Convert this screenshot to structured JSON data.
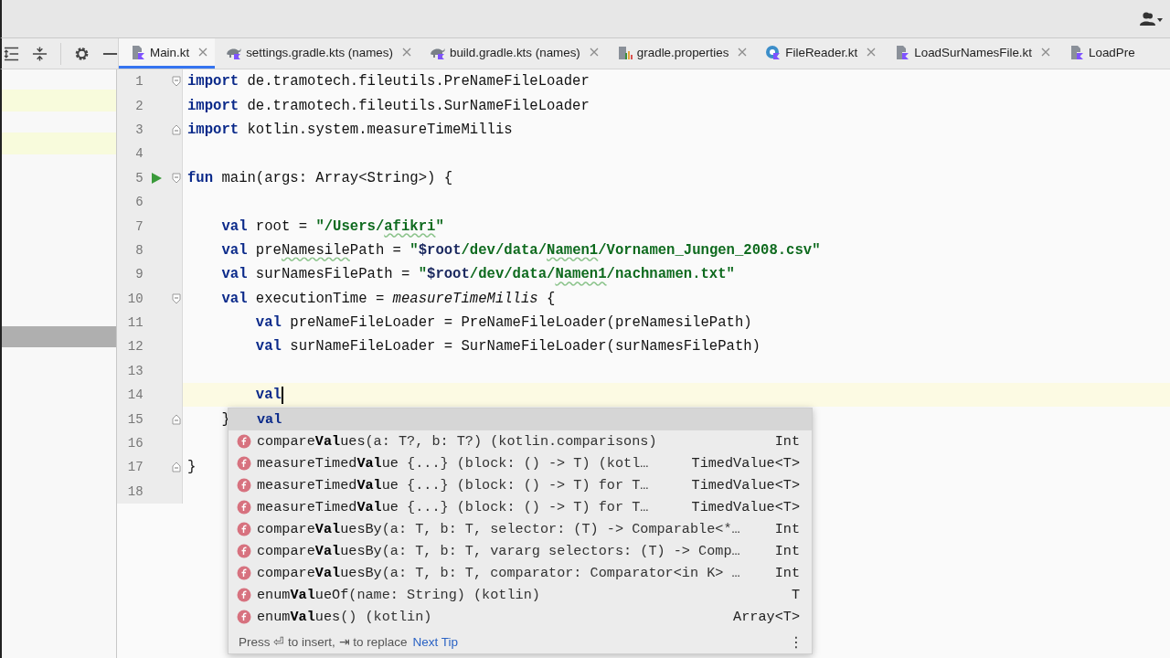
{
  "toolbar": {
    "buttons": [
      {
        "kind": "expand"
      },
      {
        "kind": "collapse"
      },
      {
        "kind": "settings"
      },
      {
        "kind": "hide"
      }
    ]
  },
  "tabs": [
    {
      "label": "Main.kt",
      "kind": "kotlin",
      "selected": true
    },
    {
      "label": "settings.gradle.kts (names)",
      "kind": "gradle",
      "selected": false
    },
    {
      "label": "build.gradle.kts (names)",
      "kind": "gradle",
      "selected": false
    },
    {
      "label": "gradle.properties",
      "kind": "properties",
      "selected": false
    },
    {
      "label": "FileReader.kt",
      "kind": "class",
      "selected": false
    },
    {
      "label": "LoadSurNamesFile.kt",
      "kind": "kotlin",
      "selected": false
    },
    {
      "label": "LoadPre",
      "kind": "kotlin",
      "selected": false
    }
  ],
  "side_panel": {
    "rows": [
      {
        "kind": "changed"
      },
      {
        "kind": "blank"
      },
      {
        "kind": "changed"
      },
      {
        "kind": "blank"
      },
      {
        "kind": "blank"
      },
      {
        "kind": "blank"
      },
      {
        "kind": "blank"
      },
      {
        "kind": "blank"
      },
      {
        "kind": "blank"
      },
      {
        "kind": "blank"
      },
      {
        "kind": "blank"
      },
      {
        "kind": "selected"
      }
    ]
  },
  "editor": {
    "lines": [
      {
        "number": "1",
        "fold_start": true,
        "fold_end": false,
        "run": false,
        "current": false,
        "tokens": [
          {
            "t": "import",
            "kind": "keyword"
          },
          {
            "t": " de.tramotech.fileutils.PreNameFileLoader",
            "kind": "plain"
          }
        ]
      },
      {
        "number": "2",
        "fold_start": false,
        "fold_end": false,
        "run": false,
        "current": false,
        "tokens": [
          {
            "t": "import",
            "kind": "keyword"
          },
          {
            "t": " de.tramotech.fileutils.SurNameFileLoader",
            "kind": "plain"
          }
        ]
      },
      {
        "number": "3",
        "fold_start": false,
        "fold_end": true,
        "run": false,
        "current": false,
        "tokens": [
          {
            "t": "import",
            "kind": "keyword"
          },
          {
            "t": " kotlin.system.measureTimeMillis",
            "kind": "plain"
          }
        ]
      },
      {
        "number": "4",
        "fold_start": false,
        "fold_end": false,
        "run": false,
        "current": false
      },
      {
        "number": "5",
        "fold_start": true,
        "fold_end": false,
        "run": true,
        "current": false,
        "tokens": [
          {
            "t": "fun",
            "kind": "keyword"
          },
          {
            "t": " main(args: Array<String>) {",
            "kind": "plain"
          }
        ]
      },
      {
        "number": "6",
        "fold_start": false,
        "fold_end": false,
        "run": false,
        "current": false
      },
      {
        "number": "7",
        "fold_start": false,
        "fold_end": false,
        "run": false,
        "current": false,
        "tokens": [
          {
            "t": "    val",
            "kind": "keyword"
          },
          {
            "t": " root = ",
            "kind": "plain"
          },
          {
            "t": "\"/Users/",
            "kind": "string"
          },
          {
            "t": "afikri",
            "kind": "misspelled_string"
          },
          {
            "t": "\"",
            "kind": "string"
          }
        ]
      },
      {
        "number": "8",
        "fold_start": false,
        "fold_end": false,
        "run": false,
        "current": false,
        "tokens": [
          {
            "t": "    val",
            "kind": "keyword"
          },
          {
            "t": " pre",
            "kind": "plain"
          },
          {
            "t": "Namesile",
            "kind": "misspelled"
          },
          {
            "t": "Path = ",
            "kind": "plain"
          },
          {
            "t": "\"",
            "kind": "string"
          },
          {
            "t": "$root",
            "kind": "template"
          },
          {
            "t": "/dev/data/",
            "kind": "string"
          },
          {
            "t": "Namen1",
            "kind": "misspelled_string"
          },
          {
            "t": "/Vornamen_Jungen_2008.csv\"",
            "kind": "string"
          }
        ]
      },
      {
        "number": "9",
        "fold_start": false,
        "fold_end": false,
        "run": false,
        "current": false,
        "tokens": [
          {
            "t": "    val",
            "kind": "keyword"
          },
          {
            "t": " surNamesFilePath = ",
            "kind": "plain"
          },
          {
            "t": "\"",
            "kind": "string"
          },
          {
            "t": "$root",
            "kind": "template"
          },
          {
            "t": "/dev/data/",
            "kind": "string"
          },
          {
            "t": "Namen1",
            "kind": "misspelled_string"
          },
          {
            "t": "/nachnamen.txt\"",
            "kind": "string"
          }
        ]
      },
      {
        "number": "10",
        "fold_start": true,
        "fold_end": false,
        "run": false,
        "current": false,
        "tokens": [
          {
            "t": "    val",
            "kind": "keyword"
          },
          {
            "t": " executionTime = ",
            "kind": "plain"
          },
          {
            "t": "measureTimeMillis",
            "kind": "italic"
          },
          {
            "t": " {",
            "kind": "plain"
          }
        ]
      },
      {
        "number": "11",
        "fold_start": false,
        "fold_end": false,
        "run": false,
        "current": false,
        "tokens": [
          {
            "t": "        val",
            "kind": "keyword"
          },
          {
            "t": " preNameFileLoader = PreNameFileLoader(preNamesilePath)",
            "kind": "plain"
          }
        ]
      },
      {
        "number": "12",
        "fold_start": false,
        "fold_end": false,
        "run": false,
        "current": false,
        "tokens": [
          {
            "t": "        val",
            "kind": "keyword"
          },
          {
            "t": " surNameFileLoader = SurNameFileLoader(surNamesFilePath)",
            "kind": "plain"
          }
        ]
      },
      {
        "number": "13",
        "fold_start": false,
        "fold_end": false,
        "run": false,
        "current": false
      },
      {
        "number": "14",
        "fold_start": false,
        "fold_end": false,
        "run": false,
        "current": true,
        "tokens": [
          {
            "t": "        val",
            "kind": "keyword"
          }
        ]
      },
      {
        "number": "15",
        "fold_start": false,
        "fold_end": true,
        "run": false,
        "current": false,
        "tokens": [
          {
            "t": "    }",
            "kind": "plain"
          }
        ]
      },
      {
        "number": "16",
        "fold_start": false,
        "fold_end": false,
        "run": false,
        "current": false
      },
      {
        "number": "17",
        "fold_start": false,
        "fold_end": true,
        "run": false,
        "current": false,
        "tokens": [
          {
            "t": "}",
            "kind": "plain"
          }
        ]
      },
      {
        "number": "18",
        "fold_start": false,
        "fold_end": false,
        "run": false,
        "current": false
      }
    ]
  },
  "completion": {
    "items": [
      {
        "kind": "keyword",
        "name": "val",
        "selected": true
      },
      {
        "kind": "function",
        "name": "compare**Val**ues",
        "detail": "(a: T?, b: T?) (kotlin.comparisons)",
        "type": "Int",
        "selected": false
      },
      {
        "kind": "function",
        "name": "measureTimed**Val**ue",
        "detail": " {...} (block: () -> T) (kotl…",
        "type": "TimedValue<T>",
        "selected": false
      },
      {
        "kind": "function",
        "name": "measureTimed**Val**ue",
        "detail": " {...} (block: () -> T) for T…",
        "type": "TimedValue<T>",
        "selected": false
      },
      {
        "kind": "function",
        "name": "measureTimed**Val**ue",
        "detail": " {...} (block: () -> T) for T…",
        "type": "TimedValue<T>",
        "selected": false
      },
      {
        "kind": "function",
        "name": "compare**Val**uesBy",
        "detail": "(a: T, b: T, selector: (T) -> Comparable<*…",
        "type": "Int",
        "selected": false
      },
      {
        "kind": "function",
        "name": "compare**Val**uesBy",
        "detail": "(a: T, b: T, vararg selectors: (T) -> Comp…",
        "type": "Int",
        "selected": false
      },
      {
        "kind": "function",
        "name": "compare**Val**uesBy",
        "detail": "(a: T, b: T, comparator: Comparator<in K> …",
        "type": "Int",
        "selected": false
      },
      {
        "kind": "function",
        "name": "enum**Val**ueOf",
        "detail": "(name: String) (kotlin)",
        "type": "T",
        "selected": false
      },
      {
        "kind": "function",
        "name": "enum**Val**ues",
        "detail": "() (kotlin)",
        "type": "Array<T>",
        "selected": false
      }
    ],
    "hint": "Press ⏎ to insert, ⇥ to replace",
    "link": "Next Tip",
    "menu": "⋮"
  }
}
